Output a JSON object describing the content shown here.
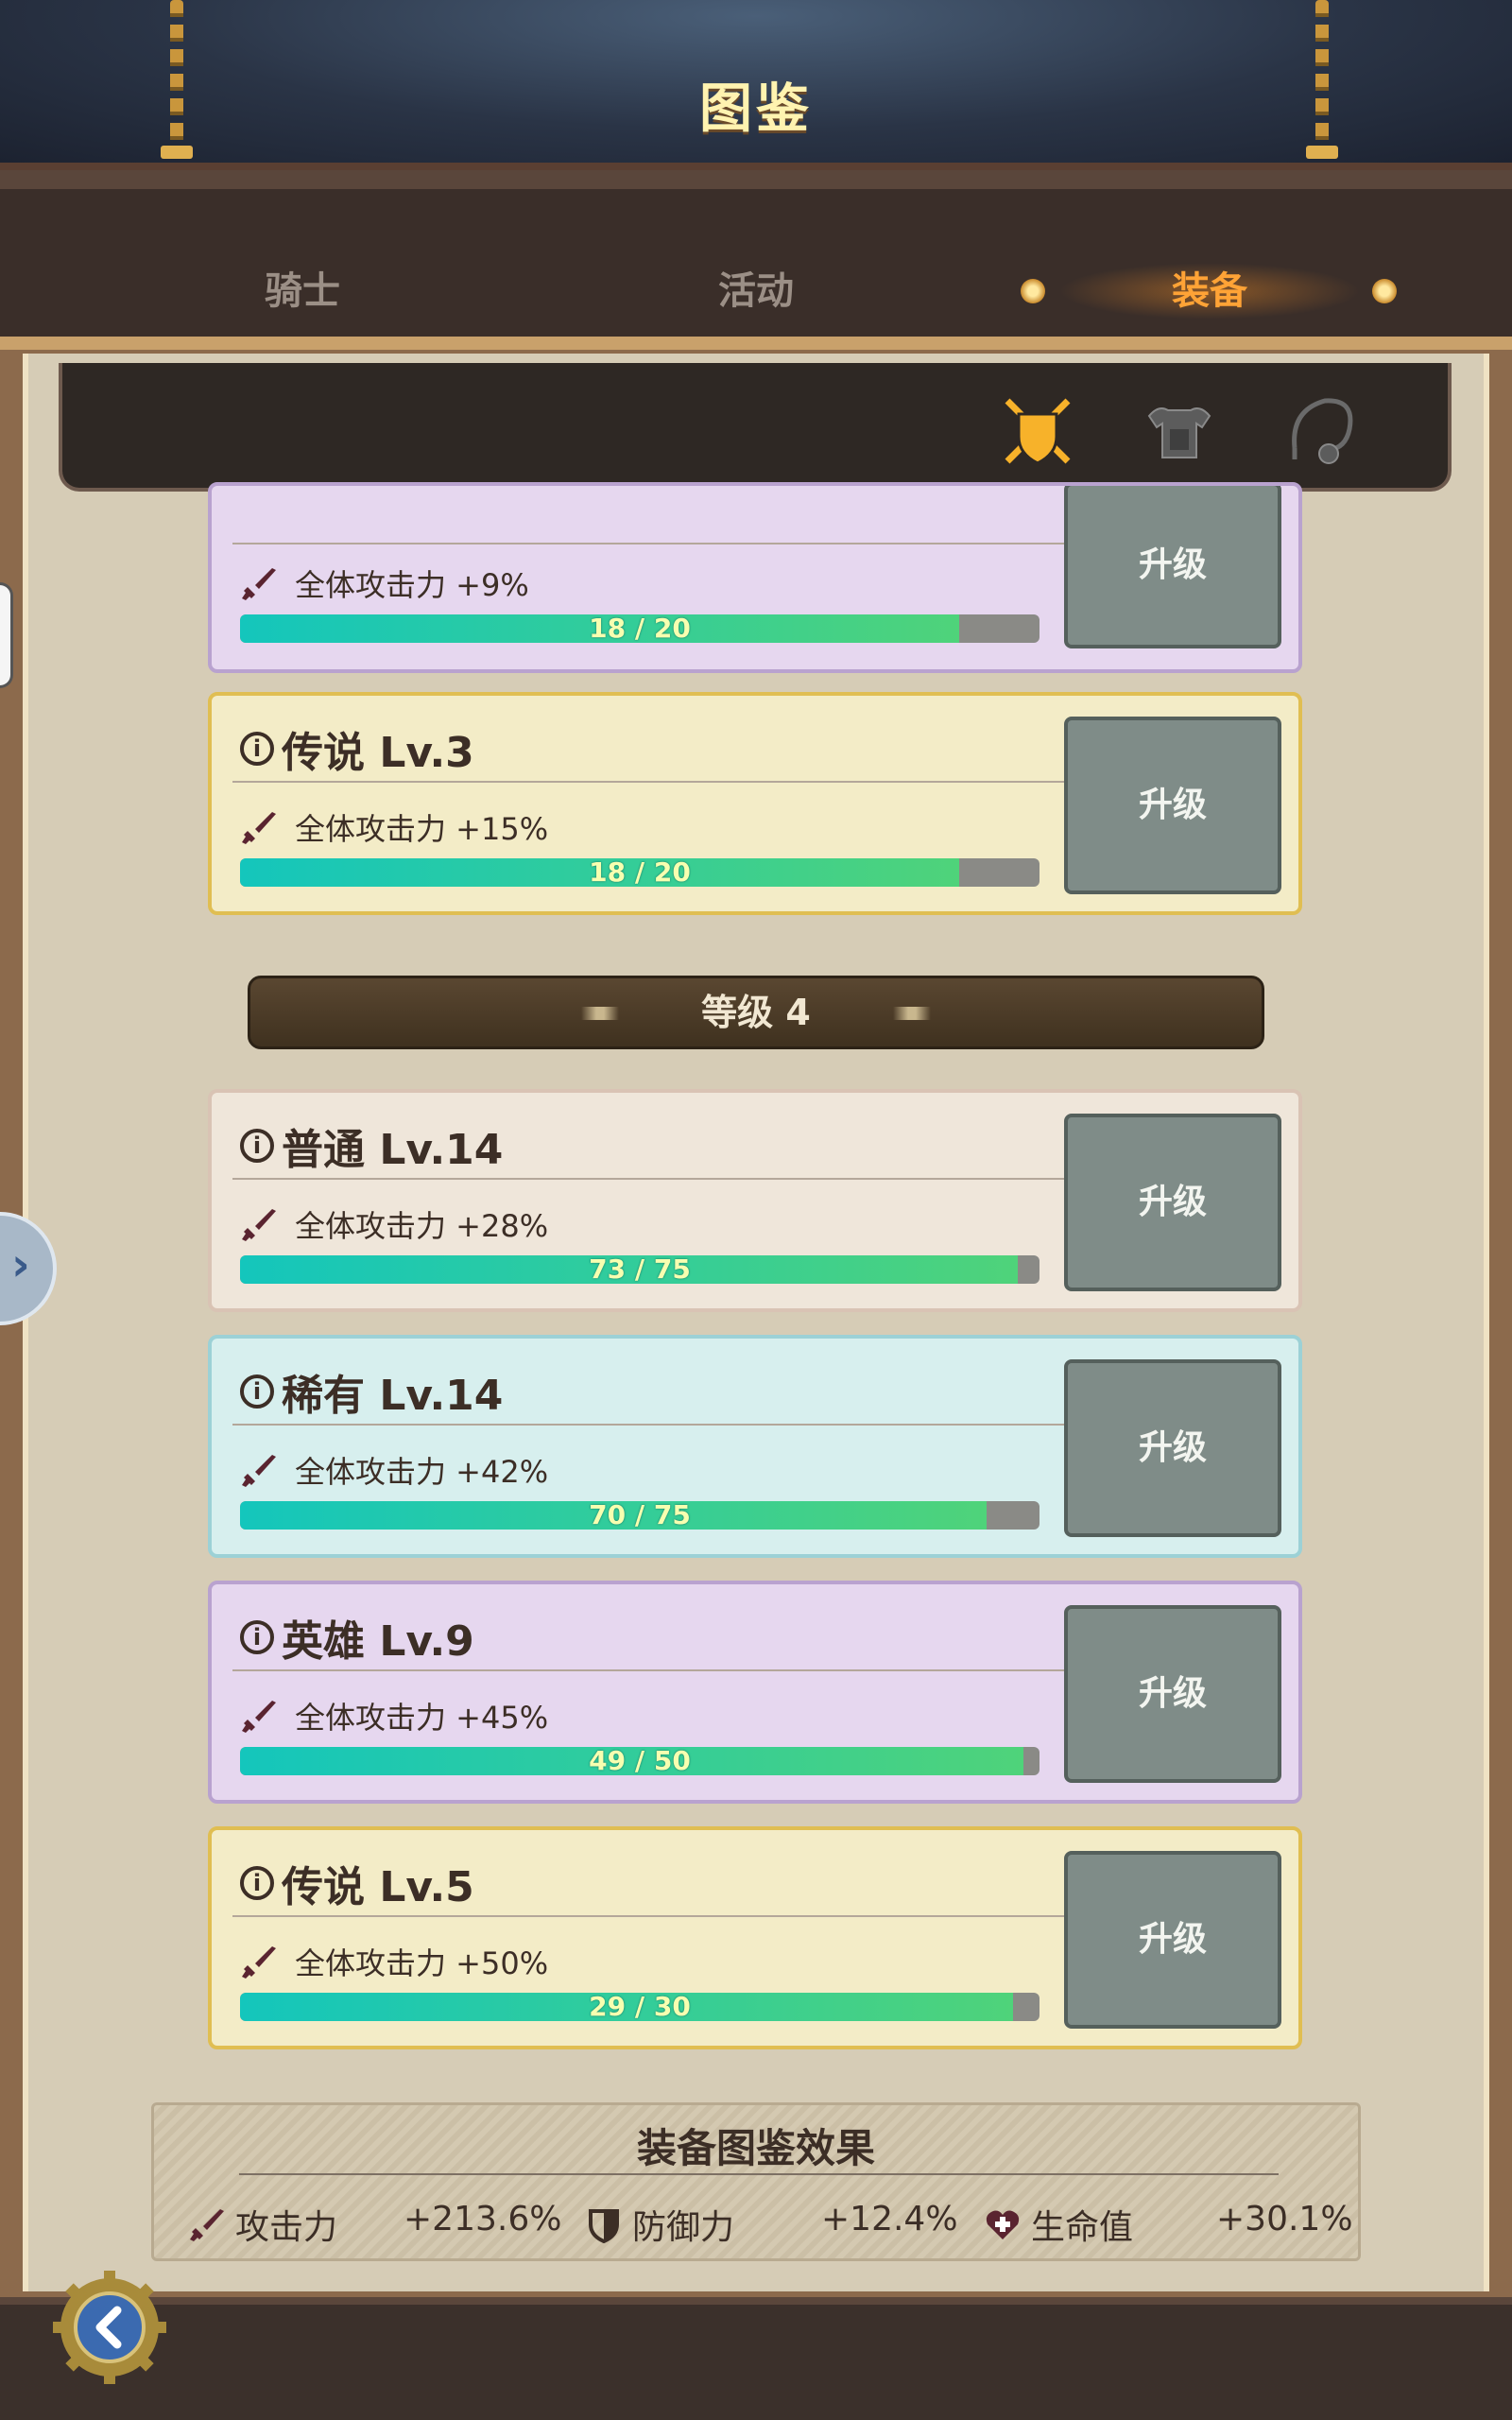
{
  "header": {
    "title": "图鉴"
  },
  "tabs": [
    {
      "label": "骑士",
      "active": false
    },
    {
      "label": "活动",
      "active": false
    },
    {
      "label": "装备",
      "active": true
    }
  ],
  "filters": [
    {
      "icon": "crossed-swords-shield-icon",
      "active": true,
      "color": "#f7b22a"
    },
    {
      "icon": "armor-icon",
      "active": false,
      "color": "#5c5c5c"
    },
    {
      "icon": "necklace-icon",
      "active": false,
      "color": "#5c5c5c"
    }
  ],
  "cards_top": [
    {
      "rarity": "epic",
      "title": "",
      "bonus": "全体攻击力 +9%",
      "current": 18,
      "max": 20,
      "progress_text": "18 / 20",
      "button": "升级"
    },
    {
      "rarity": "legend",
      "title": "传说 Lv.3",
      "bonus": "全体攻击力 +15%",
      "current": 18,
      "max": 20,
      "progress_text": "18 / 20",
      "button": "升级"
    }
  ],
  "level_section": {
    "label": "等级 4"
  },
  "cards_level4": [
    {
      "rarity": "common",
      "title": "普通 Lv.14",
      "bonus": "全体攻击力 +28%",
      "current": 73,
      "max": 75,
      "progress_text": "73 / 75",
      "button": "升级"
    },
    {
      "rarity": "rare",
      "title": "稀有 Lv.14",
      "bonus": "全体攻击力 +42%",
      "current": 70,
      "max": 75,
      "progress_text": "70 / 75",
      "button": "升级"
    },
    {
      "rarity": "epic",
      "title": "英雄 Lv.9",
      "bonus": "全体攻击力 +45%",
      "current": 49,
      "max": 50,
      "progress_text": "49 / 50",
      "button": "升级"
    },
    {
      "rarity": "legend",
      "title": "传说 Lv.5",
      "bonus": "全体攻击力 +50%",
      "current": 29,
      "max": 30,
      "progress_text": "29 / 30",
      "button": "升级"
    }
  ],
  "effects": {
    "title": "装备图鉴效果",
    "stats": [
      {
        "icon": "sword-icon",
        "label": "攻击力",
        "value": "+213.6%"
      },
      {
        "icon": "shield-icon",
        "label": "防御力",
        "value": "+12.4%"
      },
      {
        "icon": "heart-plus-icon",
        "label": "生命值",
        "value": "+30.1%"
      }
    ]
  },
  "colors": {
    "accent": "#ffa336",
    "bar_start": "#14c6bc",
    "bar_end": "#4fd37a",
    "title": "#fff3b0"
  }
}
